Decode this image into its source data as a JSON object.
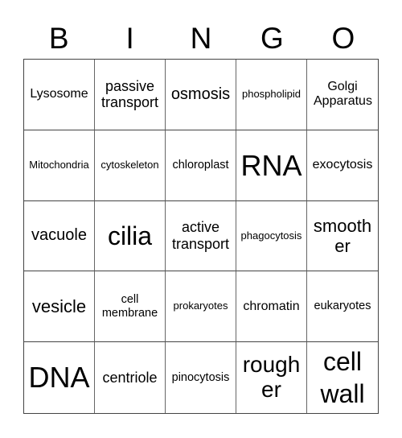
{
  "header": [
    "B",
    "I",
    "N",
    "G",
    "O"
  ],
  "cells": [
    [
      "Lysosome",
      "passive transport",
      "osmosis",
      "phospholipid",
      "Golgi Apparatus"
    ],
    [
      "Mitochondria",
      "cytoskeleton",
      "chloroplast",
      "RNA",
      "exocytosis"
    ],
    [
      "vacuole",
      "cilia",
      "active transport",
      "phagocytosis",
      "smooth er"
    ],
    [
      "vesicle",
      "cell membrane",
      "prokaryotes",
      "chromatin",
      "eukaryotes"
    ],
    [
      "DNA",
      "centriole",
      "pinocytosis",
      "rough er",
      "cell wall"
    ]
  ]
}
